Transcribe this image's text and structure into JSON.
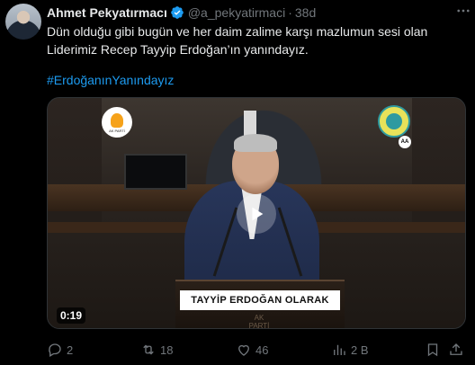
{
  "author": {
    "name": "Ahmet Pekyatırmacı",
    "handle": "@a_pekyatirmaci",
    "separator": "·",
    "time": "38d",
    "verified": true
  },
  "tweet": {
    "line1": "Dün olduğu gibi bugün ve her daim zalime karşı mazlumun sesi olan",
    "line2": "Liderimiz Recep Tayyip Erdoğan’ın yanındayız.",
    "hashtag": "#ErdoğanınYanındayız"
  },
  "media": {
    "type": "video",
    "duration": "0:19",
    "podium_text": "TAYYİP ERDOĞAN OLARAK",
    "logo_left_text": "AK PARTİ",
    "logo_right_badge": "AA",
    "podium_logo_text": "AK PARTİ"
  },
  "actions": {
    "replies": "2",
    "reposts": "18",
    "likes": "46",
    "views": "2 B"
  },
  "colors": {
    "background": "#000000",
    "text": "#e7e9ea",
    "secondary": "#71767b",
    "link": "#1d9bf0",
    "verified": "#1d9bf0"
  },
  "icons": [
    "verified-badge-icon",
    "more-icon",
    "play-icon",
    "reply-icon",
    "repost-icon",
    "like-icon",
    "views-icon",
    "bookmark-icon",
    "share-icon"
  ]
}
